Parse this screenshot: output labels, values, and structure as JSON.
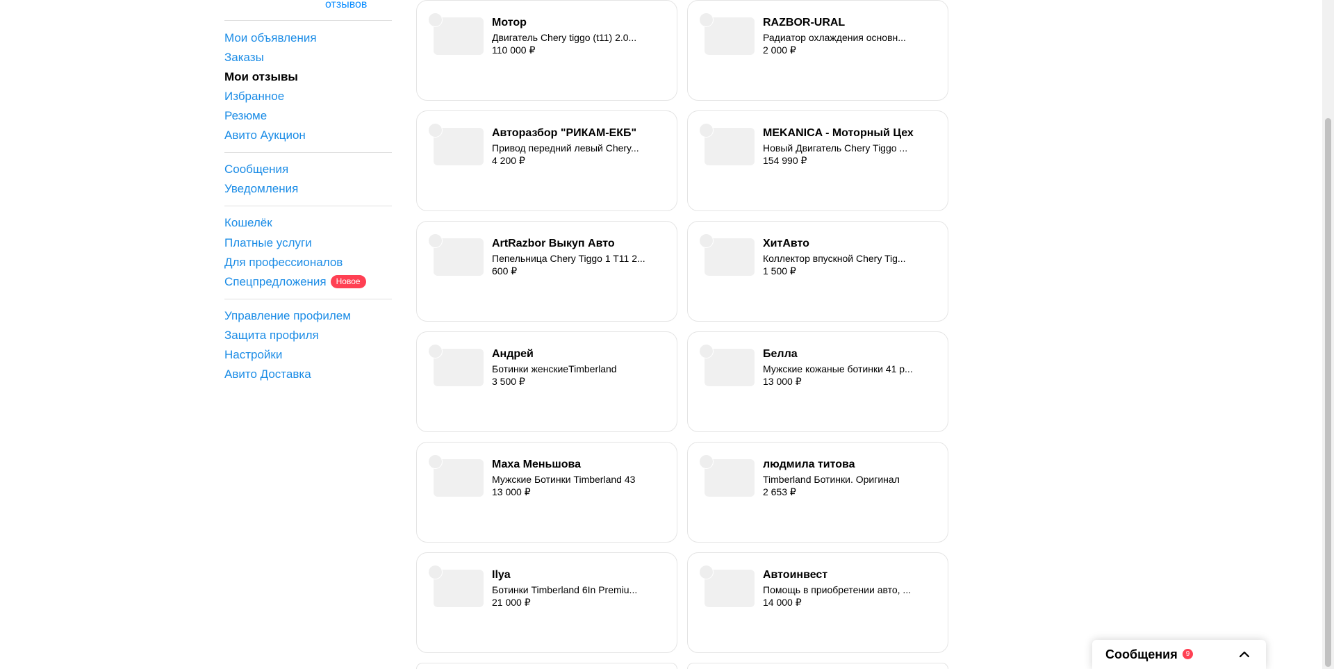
{
  "sidebar": {
    "reviews_link": "отзывов",
    "groups": [
      [
        {
          "label": "Мои объявления",
          "name": "sidebar-item-my-ads"
        },
        {
          "label": "Заказы",
          "name": "sidebar-item-orders"
        },
        {
          "label": "Мои отзывы",
          "name": "sidebar-item-my-reviews",
          "active": true
        },
        {
          "label": "Избранное",
          "name": "sidebar-item-favorites"
        },
        {
          "label": "Резюме",
          "name": "sidebar-item-resume"
        },
        {
          "label": "Авито Аукцион",
          "name": "sidebar-item-avito-auction"
        }
      ],
      [
        {
          "label": "Сообщения",
          "name": "sidebar-item-messages"
        },
        {
          "label": "Уведомления",
          "name": "sidebar-item-notifications"
        }
      ],
      [
        {
          "label": "Кошелёк",
          "name": "sidebar-item-wallet"
        },
        {
          "label": "Платные услуги",
          "name": "sidebar-item-paid-services"
        },
        {
          "label": "Для профессионалов",
          "name": "sidebar-item-for-professionals"
        },
        {
          "label": "Спецпредложения",
          "name": "sidebar-item-special-offers",
          "badge": "Новое"
        }
      ],
      [
        {
          "label": "Управление профилем",
          "name": "sidebar-item-profile-management"
        },
        {
          "label": "Защита профиля",
          "name": "sidebar-item-profile-protection"
        },
        {
          "label": "Настройки",
          "name": "sidebar-item-settings"
        },
        {
          "label": "Авито Доставка",
          "name": "sidebar-item-avito-delivery"
        }
      ]
    ]
  },
  "cards": [
    {
      "seller": "Мотор",
      "title": "Двигатель Chery tiggo (t11) 2.0...",
      "price": "110 000 ₽"
    },
    {
      "seller": "RAZBOR-URAL",
      "title": "Радиатор охлаждения основн...",
      "price": "2 000 ₽"
    },
    {
      "seller": "Авторазбор \"РИКАМ-ЕКБ\"",
      "title": "Привод передний левый Chery...",
      "price": "4 200 ₽"
    },
    {
      "seller": "MEKANICA - Моторный Цех",
      "title": "Новый Двигатель Chery Tiggo ...",
      "price": "154 990 ₽"
    },
    {
      "seller": "ArtRazbor Выкуп Авто",
      "title": "Пепельница Chery Tiggo 1 T11 2...",
      "price": "600 ₽"
    },
    {
      "seller": "ХитАвто",
      "title": "Коллектор впускной Chery Tig...",
      "price": "1 500 ₽"
    },
    {
      "seller": "Андрей",
      "title": "Ботинки женскиеTimberland",
      "price": "3 500 ₽"
    },
    {
      "seller": "Белла",
      "title": "Мужские кожаные ботинки 41 р...",
      "price": "13 000 ₽"
    },
    {
      "seller": "Маха Меньшова",
      "title": "Мужские Ботинки Timberland 43",
      "price": "13 000 ₽"
    },
    {
      "seller": "людмила титова",
      "title": "Timberland Ботинки. Оригинал",
      "price": "2 653 ₽"
    },
    {
      "seller": "Ilya",
      "title": "Ботинки Timberland 6In Premiu...",
      "price": "21 000 ₽"
    },
    {
      "seller": "Автоинвест",
      "title": "Помощь в приобретении авто, ...",
      "price": "14 000 ₽"
    }
  ],
  "messages_bar": {
    "label": "Сообщения",
    "count": "9",
    "icon": "chevron-up-icon"
  },
  "colors": {
    "link": "#1b8ce6",
    "badge": "#ff4053"
  }
}
